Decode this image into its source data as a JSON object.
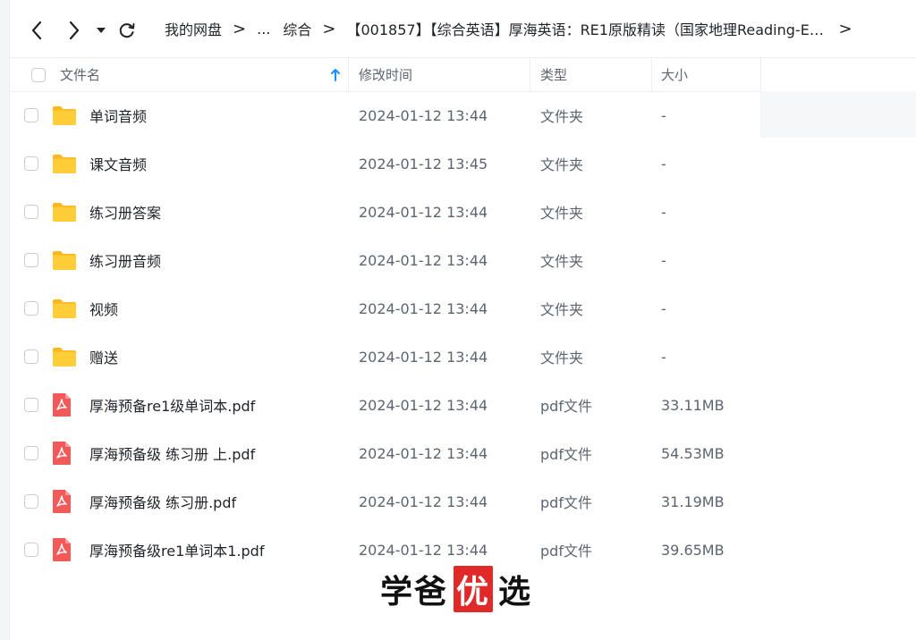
{
  "toolbar": {
    "back_icon": "chevron-left-icon",
    "forward_icon": "chevron-right-icon",
    "history_icon": "caret-down-icon",
    "refresh_icon": "refresh-icon"
  },
  "breadcrumb": {
    "root": "我的网盘",
    "ellipsis": "...",
    "parent": "综合",
    "current": "【001857】【综合英语】厚海英语：RE1原版精读（国家地理Reading-Ex...",
    "separator": ">"
  },
  "table": {
    "headers": {
      "name": "文件名",
      "modified": "修改时间",
      "type": "类型",
      "size": "大小"
    },
    "sort_icon": "arrow-up-icon",
    "rows": [
      {
        "name": "单词音频",
        "modified": "2024-01-12 13:44",
        "type": "文件夹",
        "size": "-",
        "icon": "folder-icon"
      },
      {
        "name": "课文音频",
        "modified": "2024-01-12 13:45",
        "type": "文件夹",
        "size": "-",
        "icon": "folder-icon"
      },
      {
        "name": "练习册答案",
        "modified": "2024-01-12 13:44",
        "type": "文件夹",
        "size": "-",
        "icon": "folder-icon"
      },
      {
        "name": "练习册音频",
        "modified": "2024-01-12 13:44",
        "type": "文件夹",
        "size": "-",
        "icon": "folder-icon"
      },
      {
        "name": "视频",
        "modified": "2024-01-12 13:44",
        "type": "文件夹",
        "size": "-",
        "icon": "folder-icon"
      },
      {
        "name": "赠送",
        "modified": "2024-01-12 13:44",
        "type": "文件夹",
        "size": "-",
        "icon": "folder-icon"
      },
      {
        "name": "厚海预备re1级单词本.pdf",
        "modified": "2024-01-12 13:44",
        "type": "pdf文件",
        "size": "33.11MB",
        "icon": "pdf-icon"
      },
      {
        "name": "厚海预备级 练习册 上.pdf",
        "modified": "2024-01-12 13:44",
        "type": "pdf文件",
        "size": "54.53MB",
        "icon": "pdf-icon"
      },
      {
        "name": "厚海预备级 练习册.pdf",
        "modified": "2024-01-12 13:44",
        "type": "pdf文件",
        "size": "31.19MB",
        "icon": "pdf-icon"
      },
      {
        "name": "厚海预备级re1单词本1.pdf",
        "modified": "2024-01-12 13:44",
        "type": "pdf文件",
        "size": "39.65MB",
        "icon": "pdf-icon"
      }
    ]
  },
  "watermark": {
    "part1": "学爸",
    "part2": "优",
    "part3": "选"
  },
  "colors": {
    "folder": "#ffc53d",
    "pdf": "#f25a5a",
    "sort_arrow": "#1890ff",
    "watermark_red": "#e02a2a"
  }
}
